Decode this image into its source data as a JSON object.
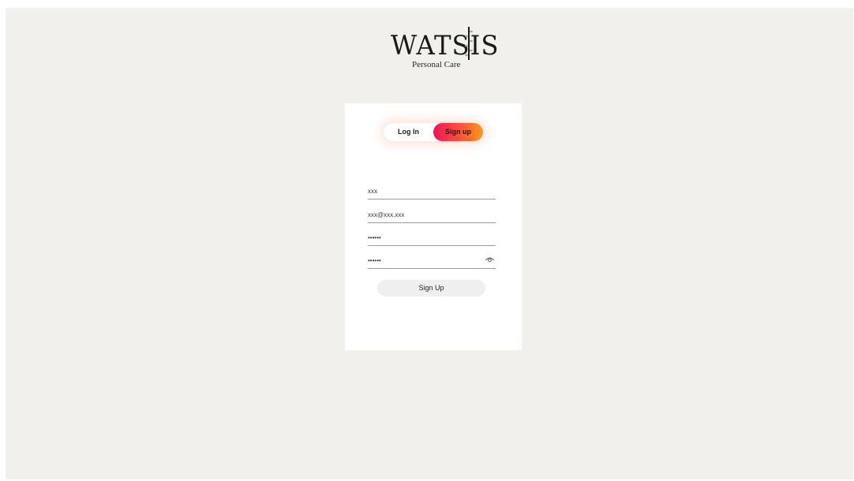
{
  "brand": {
    "name": "WATSIS",
    "tagline": "Personal Care",
    "leaf_icon": "vine-leaf-icon"
  },
  "auth_toggle": {
    "login_label": "Log In",
    "signup_label": "Sign up",
    "active": "signup",
    "accent_start": "#f0145a",
    "accent_end": "#ff9a1a"
  },
  "form": {
    "name_value": "xxx",
    "email_value": "xxx@xxx.xxx",
    "password_value": "••••••",
    "confirm_password_value": "••••••",
    "reveal_icon": "eye-icon",
    "submit_label": "Sign Up"
  },
  "colors": {
    "page_background": "#f1f0ed",
    "card_background": "#ffffff",
    "button_background": "#efefef"
  }
}
